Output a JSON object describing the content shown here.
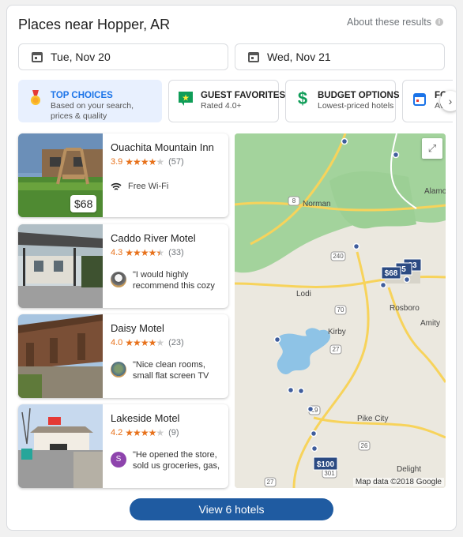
{
  "header": {
    "title": "Places near Hopper, AR",
    "about": "About these results",
    "info_glyph": "i"
  },
  "dates": {
    "checkin": "Tue, Nov 20",
    "checkout": "Wed, Nov 21"
  },
  "filters": [
    {
      "title": "TOP CHOICES",
      "subtitle": "Based on your search, prices & quality",
      "icon": "medal-icon",
      "active": true
    },
    {
      "title": "GUEST FAVORITES",
      "subtitle": "Rated 4.0+",
      "icon": "star-badge-icon",
      "active": false
    },
    {
      "title": "BUDGET OPTIONS",
      "subtitle": "Lowest-priced hotels",
      "icon": "dollar-icon",
      "active": false
    },
    {
      "title": "FO",
      "subtitle": "Ava",
      "icon": "calendar-icon",
      "active": false
    }
  ],
  "hotels": [
    {
      "name": "Ouachita Mountain Inn",
      "rating": "3.9",
      "stars": 4,
      "reviews": "(57)",
      "amenity": "Free Wi-Fi",
      "price": "$68"
    },
    {
      "name": "Caddo River Motel",
      "rating": "4.3",
      "stars": 4.5,
      "reviews": "(33)",
      "quote": "\"I would highly recommend this cozy"
    },
    {
      "name": "Daisy Motel",
      "rating": "4.0",
      "stars": 4,
      "reviews": "(23)",
      "quote": "\"Nice clean rooms, small flat screen TV"
    },
    {
      "name": "Lakeside Motel",
      "rating": "4.2",
      "stars": 4,
      "reviews": "(9)",
      "quote": "\"He opened the store, sold us groceries, gas,",
      "avatar_letter": "S"
    }
  ],
  "map": {
    "places": [
      "Alamo",
      "Norman",
      "Lodi",
      "Rosboro",
      "Amity",
      "Kirby",
      "Pike City",
      "Delight"
    ],
    "routes": [
      "8",
      "240",
      "70",
      "27",
      "19",
      "26",
      "301",
      "27"
    ],
    "price_pins": [
      "$68",
      "5",
      "23",
      "$100"
    ],
    "credit": "Map data ©2018 Google"
  },
  "view_button": "View 6 hotels",
  "colors": {
    "accent": "#1a73e8",
    "button": "#1f5ba1",
    "star": "#e7711b"
  }
}
